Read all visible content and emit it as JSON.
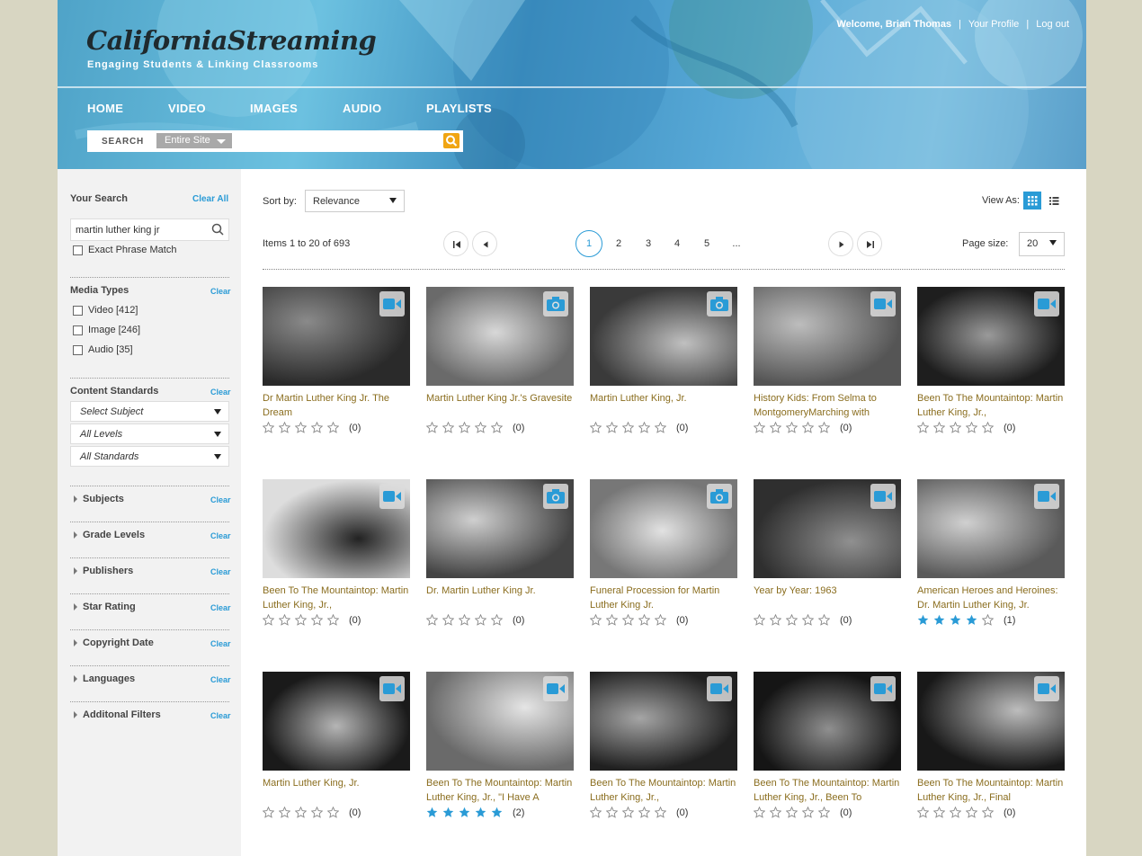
{
  "header": {
    "logo": "CaliforniaStreaming",
    "tagline": "Engaging Students & Linking Classrooms",
    "welcome": "Welcome, Brian Thomas",
    "profile_link": "Your Profile",
    "logout_link": "Log out",
    "nav": [
      "HOME",
      "VIDEO",
      "IMAGES",
      "AUDIO",
      "PLAYLISTS"
    ],
    "search_label": "SEARCH",
    "search_scope": "Entire Site"
  },
  "sidebar": {
    "your_search": "Your Search",
    "clear_all": "Clear All",
    "query": "martin luther king jr",
    "exact_phrase": "Exact Phrase Match",
    "media_types_title": "Media Types",
    "clear": "Clear",
    "media_types": [
      "Video [412]",
      "Image [246]",
      "Audio [35]"
    ],
    "content_standards_title": "Content Standards",
    "selects": [
      "Select Subject",
      "All Levels",
      "All Standards"
    ],
    "facets": [
      "Subjects",
      "Grade Levels",
      "Publishers",
      "Star Rating",
      "Copyright Date",
      "Languages",
      "Additonal Filters"
    ]
  },
  "toolbar": {
    "sort_label": "Sort by:",
    "sort_value": "Relevance",
    "view_as": "View As:",
    "items_text": "Items 1 to 20 of 693",
    "pages": [
      "1",
      "2",
      "3",
      "4",
      "5",
      "..."
    ],
    "page_size_label": "Page size:",
    "page_size": "20"
  },
  "results": [
    {
      "title": "Dr Martin Luther King Jr. The Dream",
      "type": "video",
      "stars": 0,
      "count": "(0)"
    },
    {
      "title": "Martin Luther King Jr.'s Gravesite",
      "type": "image",
      "stars": 0,
      "count": "(0)"
    },
    {
      "title": "Martin Luther King, Jr.",
      "type": "image",
      "stars": 0,
      "count": "(0)"
    },
    {
      "title": "History Kids: From Selma to MontgomeryMarching with",
      "type": "video",
      "stars": 0,
      "count": "(0)"
    },
    {
      "title": "Been To The Mountaintop: Martin Luther King, Jr.,",
      "type": "video",
      "stars": 0,
      "count": "(0)"
    },
    {
      "title": "Been To The Mountaintop: Martin Luther King, Jr.,",
      "type": "video",
      "stars": 0,
      "count": "(0)"
    },
    {
      "title": "Dr. Martin Luther King Jr.",
      "type": "image",
      "stars": 0,
      "count": "(0)"
    },
    {
      "title": "Funeral Procession for Martin Luther King Jr.",
      "type": "image",
      "stars": 0,
      "count": "(0)"
    },
    {
      "title": "Year by Year: 1963",
      "type": "video",
      "stars": 0,
      "count": "(0)"
    },
    {
      "title": "American Heroes and Heroines: Dr. Martin Luther King, Jr.",
      "type": "video",
      "stars": 4,
      "count": "(1)"
    },
    {
      "title": "Martin Luther King, Jr.",
      "type": "video",
      "stars": 0,
      "count": "(0)"
    },
    {
      "title": "Been To The Mountaintop: Martin Luther King, Jr., \"I Have A",
      "type": "video",
      "stars": 5,
      "count": "(2)"
    },
    {
      "title": "Been To The Mountaintop: Martin Luther King, Jr.,",
      "type": "video",
      "stars": 0,
      "count": "(0)"
    },
    {
      "title": "Been To The Mountaintop: Martin Luther King, Jr., Been To",
      "type": "video",
      "stars": 0,
      "count": "(0)"
    },
    {
      "title": "Been To The Mountaintop: Martin Luther King, Jr., Final",
      "type": "video",
      "stars": 0,
      "count": "(0)"
    }
  ],
  "colors": {
    "accent": "#2a9bd6",
    "title_link": "#8a6d1e",
    "star_filled": "#2a9bd6"
  }
}
